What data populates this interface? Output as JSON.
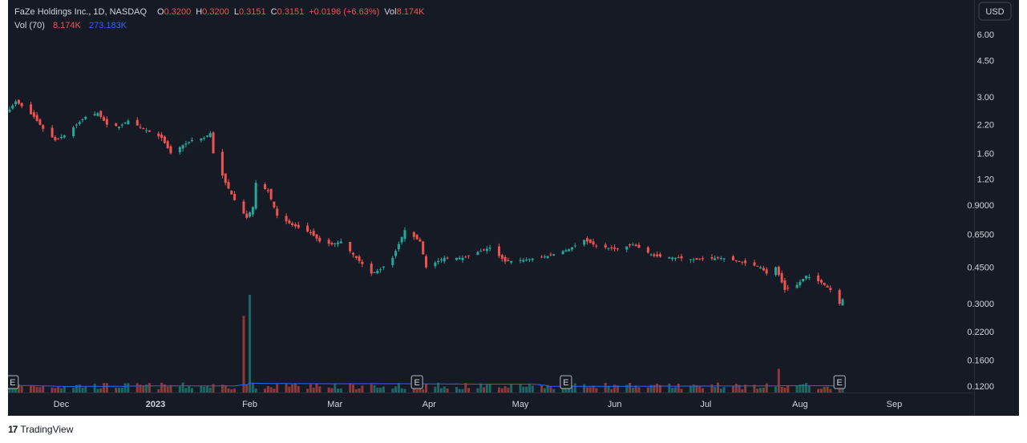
{
  "legend": {
    "symbol": "FaZe Holdings Inc., 1D, NASDAQ",
    "o_label": "O",
    "o_value": "0.3200",
    "h_label": "H",
    "h_value": "0.3200",
    "l_label": "L",
    "l_value": "0.3151",
    "c_label": "C",
    "c_value": "0.3151",
    "change": "+0.0196 (+6.63%)",
    "vol_label": "Vol",
    "vol_value": "8.174K",
    "vol_ma_label": "Vol (70)",
    "vol_ma_value1": "8.174K",
    "vol_ma_value2": "273.183K"
  },
  "currency_button": "USD",
  "earnings_marker": "E",
  "footer": {
    "brand": "TradingView",
    "logo": "17"
  },
  "colors": {
    "up": "#26a69a",
    "down": "#ef5350",
    "volume_ma": "#2962ff",
    "background": "#161a25",
    "text": "#d1d4dc"
  },
  "chart_data": {
    "type": "candlestick",
    "y_scale": "log",
    "y_ticks": [
      "6.00",
      "4.50",
      "3.00",
      "2.20",
      "1.60",
      "1.20",
      "0.9000",
      "0.6500",
      "0.4500",
      "0.3000",
      "0.2200",
      "0.1600",
      "0.1200"
    ],
    "x_ticks": [
      "Dec",
      "2023",
      "Feb",
      "Mar",
      "Apr",
      "May",
      "Jun",
      "Jul",
      "Aug",
      "Sep"
    ],
    "earnings_events": [
      "2022-11-15",
      "2023-03-28",
      "2023-05-16",
      "2023-08-14"
    ],
    "close_series": [
      [
        "2022-11-14",
        2.6
      ],
      [
        "2022-11-16",
        2.85
      ],
      [
        "2022-11-18",
        2.7
      ],
      [
        "2022-11-22",
        2.4
      ],
      [
        "2022-11-25",
        2.1
      ],
      [
        "2022-11-29",
        1.85
      ],
      [
        "2022-12-02",
        1.95
      ],
      [
        "2022-12-06",
        2.2
      ],
      [
        "2022-12-09",
        2.4
      ],
      [
        "2022-12-13",
        2.5
      ],
      [
        "2022-12-16",
        2.2
      ],
      [
        "2022-12-20",
        2.15
      ],
      [
        "2022-12-23",
        2.3
      ],
      [
        "2022-12-28",
        2.1
      ],
      [
        "2023-01-03",
        1.9
      ],
      [
        "2023-01-06",
        1.6
      ],
      [
        "2023-01-10",
        1.75
      ],
      [
        "2023-01-13",
        1.85
      ],
      [
        "2023-01-17",
        1.9
      ],
      [
        "2023-01-19",
        2.0
      ],
      [
        "2023-01-20",
        1.6
      ],
      [
        "2023-01-24",
        1.15
      ],
      [
        "2023-01-27",
        0.95
      ],
      [
        "2023-01-31",
        0.78
      ],
      [
        "2023-02-02",
        0.88
      ],
      [
        "2023-02-03",
        1.15
      ],
      [
        "2023-02-07",
        1.05
      ],
      [
        "2023-02-10",
        0.8
      ],
      [
        "2023-02-15",
        0.72
      ],
      [
        "2023-02-21",
        0.66
      ],
      [
        "2023-02-24",
        0.6
      ],
      [
        "2023-02-28",
        0.58
      ],
      [
        "2023-03-03",
        0.6
      ],
      [
        "2023-03-08",
        0.5
      ],
      [
        "2023-03-13",
        0.42
      ],
      [
        "2023-03-16",
        0.44
      ],
      [
        "2023-03-20",
        0.5
      ],
      [
        "2023-03-24",
        0.68
      ],
      [
        "2023-03-29",
        0.6
      ],
      [
        "2023-03-31",
        0.45
      ],
      [
        "2023-04-06",
        0.5
      ],
      [
        "2023-04-12",
        0.5
      ],
      [
        "2023-04-18",
        0.54
      ],
      [
        "2023-04-21",
        0.56
      ],
      [
        "2023-04-26",
        0.48
      ],
      [
        "2023-05-03",
        0.49
      ],
      [
        "2023-05-10",
        0.51
      ],
      [
        "2023-05-17",
        0.55
      ],
      [
        "2023-05-22",
        0.61
      ],
      [
        "2023-05-26",
        0.57
      ],
      [
        "2023-06-02",
        0.55
      ],
      [
        "2023-06-07",
        0.58
      ],
      [
        "2023-06-14",
        0.51
      ],
      [
        "2023-06-21",
        0.5
      ],
      [
        "2023-06-28",
        0.49
      ],
      [
        "2023-07-06",
        0.5
      ],
      [
        "2023-07-12",
        0.48
      ],
      [
        "2023-07-19",
        0.45
      ],
      [
        "2023-07-21",
        0.42
      ],
      [
        "2023-07-24",
        0.45
      ],
      [
        "2023-07-27",
        0.35
      ],
      [
        "2023-07-31",
        0.37
      ],
      [
        "2023-08-03",
        0.41
      ],
      [
        "2023-08-08",
        0.38
      ],
      [
        "2023-08-11",
        0.35
      ],
      [
        "2023-08-14",
        0.3
      ],
      [
        "2023-08-15",
        0.315
      ]
    ],
    "volume_highlights": [
      [
        "2023-01-30",
        "2,900K"
      ],
      [
        "2023-02-01",
        "3,700K"
      ],
      [
        "2023-07-25",
        "900K"
      ]
    ],
    "volume_ma_length": 70
  }
}
